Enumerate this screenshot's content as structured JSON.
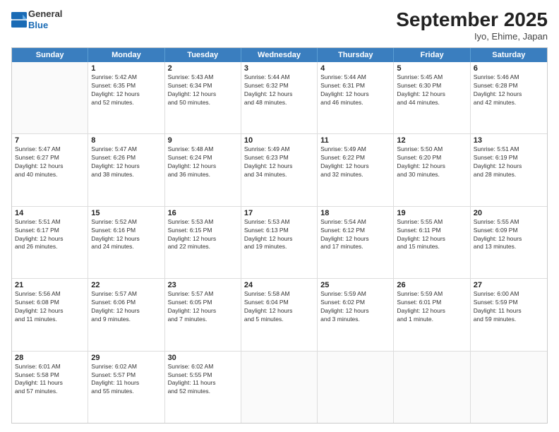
{
  "header": {
    "logo_general": "General",
    "logo_blue": "Blue",
    "month": "September 2025",
    "location": "Iyo, Ehime, Japan"
  },
  "weekdays": [
    "Sunday",
    "Monday",
    "Tuesday",
    "Wednesday",
    "Thursday",
    "Friday",
    "Saturday"
  ],
  "weeks": [
    [
      {
        "day": "",
        "info": ""
      },
      {
        "day": "1",
        "info": "Sunrise: 5:42 AM\nSunset: 6:35 PM\nDaylight: 12 hours\nand 52 minutes."
      },
      {
        "day": "2",
        "info": "Sunrise: 5:43 AM\nSunset: 6:34 PM\nDaylight: 12 hours\nand 50 minutes."
      },
      {
        "day": "3",
        "info": "Sunrise: 5:44 AM\nSunset: 6:32 PM\nDaylight: 12 hours\nand 48 minutes."
      },
      {
        "day": "4",
        "info": "Sunrise: 5:44 AM\nSunset: 6:31 PM\nDaylight: 12 hours\nand 46 minutes."
      },
      {
        "day": "5",
        "info": "Sunrise: 5:45 AM\nSunset: 6:30 PM\nDaylight: 12 hours\nand 44 minutes."
      },
      {
        "day": "6",
        "info": "Sunrise: 5:46 AM\nSunset: 6:28 PM\nDaylight: 12 hours\nand 42 minutes."
      }
    ],
    [
      {
        "day": "7",
        "info": "Sunrise: 5:47 AM\nSunset: 6:27 PM\nDaylight: 12 hours\nand 40 minutes."
      },
      {
        "day": "8",
        "info": "Sunrise: 5:47 AM\nSunset: 6:26 PM\nDaylight: 12 hours\nand 38 minutes."
      },
      {
        "day": "9",
        "info": "Sunrise: 5:48 AM\nSunset: 6:24 PM\nDaylight: 12 hours\nand 36 minutes."
      },
      {
        "day": "10",
        "info": "Sunrise: 5:49 AM\nSunset: 6:23 PM\nDaylight: 12 hours\nand 34 minutes."
      },
      {
        "day": "11",
        "info": "Sunrise: 5:49 AM\nSunset: 6:22 PM\nDaylight: 12 hours\nand 32 minutes."
      },
      {
        "day": "12",
        "info": "Sunrise: 5:50 AM\nSunset: 6:20 PM\nDaylight: 12 hours\nand 30 minutes."
      },
      {
        "day": "13",
        "info": "Sunrise: 5:51 AM\nSunset: 6:19 PM\nDaylight: 12 hours\nand 28 minutes."
      }
    ],
    [
      {
        "day": "14",
        "info": "Sunrise: 5:51 AM\nSunset: 6:17 PM\nDaylight: 12 hours\nand 26 minutes."
      },
      {
        "day": "15",
        "info": "Sunrise: 5:52 AM\nSunset: 6:16 PM\nDaylight: 12 hours\nand 24 minutes."
      },
      {
        "day": "16",
        "info": "Sunrise: 5:53 AM\nSunset: 6:15 PM\nDaylight: 12 hours\nand 22 minutes."
      },
      {
        "day": "17",
        "info": "Sunrise: 5:53 AM\nSunset: 6:13 PM\nDaylight: 12 hours\nand 19 minutes."
      },
      {
        "day": "18",
        "info": "Sunrise: 5:54 AM\nSunset: 6:12 PM\nDaylight: 12 hours\nand 17 minutes."
      },
      {
        "day": "19",
        "info": "Sunrise: 5:55 AM\nSunset: 6:11 PM\nDaylight: 12 hours\nand 15 minutes."
      },
      {
        "day": "20",
        "info": "Sunrise: 5:55 AM\nSunset: 6:09 PM\nDaylight: 12 hours\nand 13 minutes."
      }
    ],
    [
      {
        "day": "21",
        "info": "Sunrise: 5:56 AM\nSunset: 6:08 PM\nDaylight: 12 hours\nand 11 minutes."
      },
      {
        "day": "22",
        "info": "Sunrise: 5:57 AM\nSunset: 6:06 PM\nDaylight: 12 hours\nand 9 minutes."
      },
      {
        "day": "23",
        "info": "Sunrise: 5:57 AM\nSunset: 6:05 PM\nDaylight: 12 hours\nand 7 minutes."
      },
      {
        "day": "24",
        "info": "Sunrise: 5:58 AM\nSunset: 6:04 PM\nDaylight: 12 hours\nand 5 minutes."
      },
      {
        "day": "25",
        "info": "Sunrise: 5:59 AM\nSunset: 6:02 PM\nDaylight: 12 hours\nand 3 minutes."
      },
      {
        "day": "26",
        "info": "Sunrise: 5:59 AM\nSunset: 6:01 PM\nDaylight: 12 hours\nand 1 minute."
      },
      {
        "day": "27",
        "info": "Sunrise: 6:00 AM\nSunset: 5:59 PM\nDaylight: 11 hours\nand 59 minutes."
      }
    ],
    [
      {
        "day": "28",
        "info": "Sunrise: 6:01 AM\nSunset: 5:58 PM\nDaylight: 11 hours\nand 57 minutes."
      },
      {
        "day": "29",
        "info": "Sunrise: 6:02 AM\nSunset: 5:57 PM\nDaylight: 11 hours\nand 55 minutes."
      },
      {
        "day": "30",
        "info": "Sunrise: 6:02 AM\nSunset: 5:55 PM\nDaylight: 11 hours\nand 52 minutes."
      },
      {
        "day": "",
        "info": ""
      },
      {
        "day": "",
        "info": ""
      },
      {
        "day": "",
        "info": ""
      },
      {
        "day": "",
        "info": ""
      }
    ]
  ]
}
